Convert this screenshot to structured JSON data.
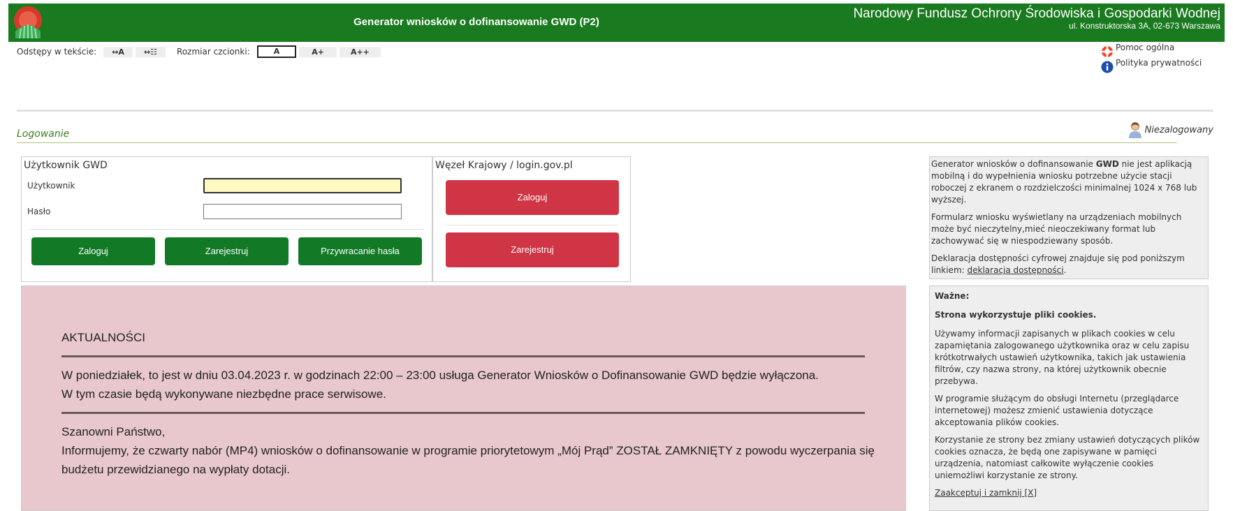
{
  "header": {
    "app_title": "Generator wniosków o dofinansowanie GWD (P2)",
    "org_name": "Narodowy Fundusz Ochrony Środowiska i Gospodarki Wodnej",
    "org_address": "ul. Konstruktorska 3A, 02-673 Warszawa",
    "bg_color": "#1a7a1f"
  },
  "accessibility": {
    "spacing_label": "Odstępy w tekście:",
    "spacing_buttons": [
      "↔A",
      "↔☷"
    ],
    "font_label": "Rozmiar czcionki:",
    "font_buttons": [
      "A",
      "A+",
      "A++"
    ],
    "selected_font": "A"
  },
  "help_links": {
    "help": "Pomoc ogólna",
    "privacy": "Polityka prywatności"
  },
  "login": {
    "section_title": "Logowanie",
    "user_status": "Niezalogowany",
    "gwd_box": {
      "title": "Użytkownik GWD",
      "user_label": "Użytkownik",
      "password_label": "Hasło",
      "user_value": "",
      "password_value": "",
      "login_button": "Zaloguj",
      "register_button": "Zarejestruj",
      "recover_button": "Przywracanie hasła"
    },
    "national_box": {
      "title": "Węzeł Krajowy / login.gov.pl",
      "login_button": "Zaloguj",
      "register_button": "Zarejestruj"
    }
  },
  "news": {
    "title": "AKTUALNOŚCI",
    "paragraph1": "W poniedziałek, to jest w dniu 03.04.2023 r. w godzinach 22:00 – 23:00 usługa Generator Wniosków o Dofinansowanie GWD będzie wyłączona.",
    "paragraph2": "W tym czasie będą wykonywane niezbędne prace serwisowe.",
    "greeting": "Szanowni Państwo,",
    "paragraph3": "Informujemy, że czwarty nabór (MP4) wniosków o dofinansowanie w programie priorytetowym „Mój Prąd” ZOSTAŁ ZAMKNIĘTY z powodu wyczerpania się budżetu przewidzianego na wypłaty dotacji."
  },
  "info_panel": {
    "p1_before": "Generator wniosków o dofinansowanie ",
    "p1_bold": "GWD",
    "p1_after": " nie jest aplikacją mobilną i do wypełnienia wniosku potrzebne użycie stacji roboczej z ekranem o rozdzielczości minimalnej 1024 x 768 lub wyższej.",
    "p2": "Formularz wniosku wyświetlany na urządzeniach mobilnych może być nieczytelny,mieć nieoczekiwany format lub zachowywać się w niespodziewany sposób.",
    "p3_before": "Deklaracja dostępności cyfrowej znajduje się pod poniższym linkiem: ",
    "p3_link": "deklaracja dostępności",
    "p3_after": "."
  },
  "cookies_panel": {
    "important": "Ważne:",
    "heading": "Strona wykorzystuje pliki cookies.",
    "p1": "Używamy informacji zapisanych w plikach cookies w celu zapamiętania zalogowanego użytkownika oraz w celu zapisu krótkotrwałych ustawień użytkownika, takich jak ustawienia filtrów, czy nazwa strony, na której użytkownik obecnie przebywa.",
    "p2": "W programie służącym do obsługi Internetu (przeglądarce internetowej) możesz zmienić ustawienia dotyczące akceptowania plików cookies.",
    "p3": "Korzystanie ze strony bez zmiany ustawień dotyczących plików cookies oznacza, że będą one zapisywane w pamięci urządzenia, natomiast całkowite wyłączenie cookies uniemożliwi korzystanie ze strony.",
    "accept_link": "Zaakceptuj i zamknij [X]"
  }
}
